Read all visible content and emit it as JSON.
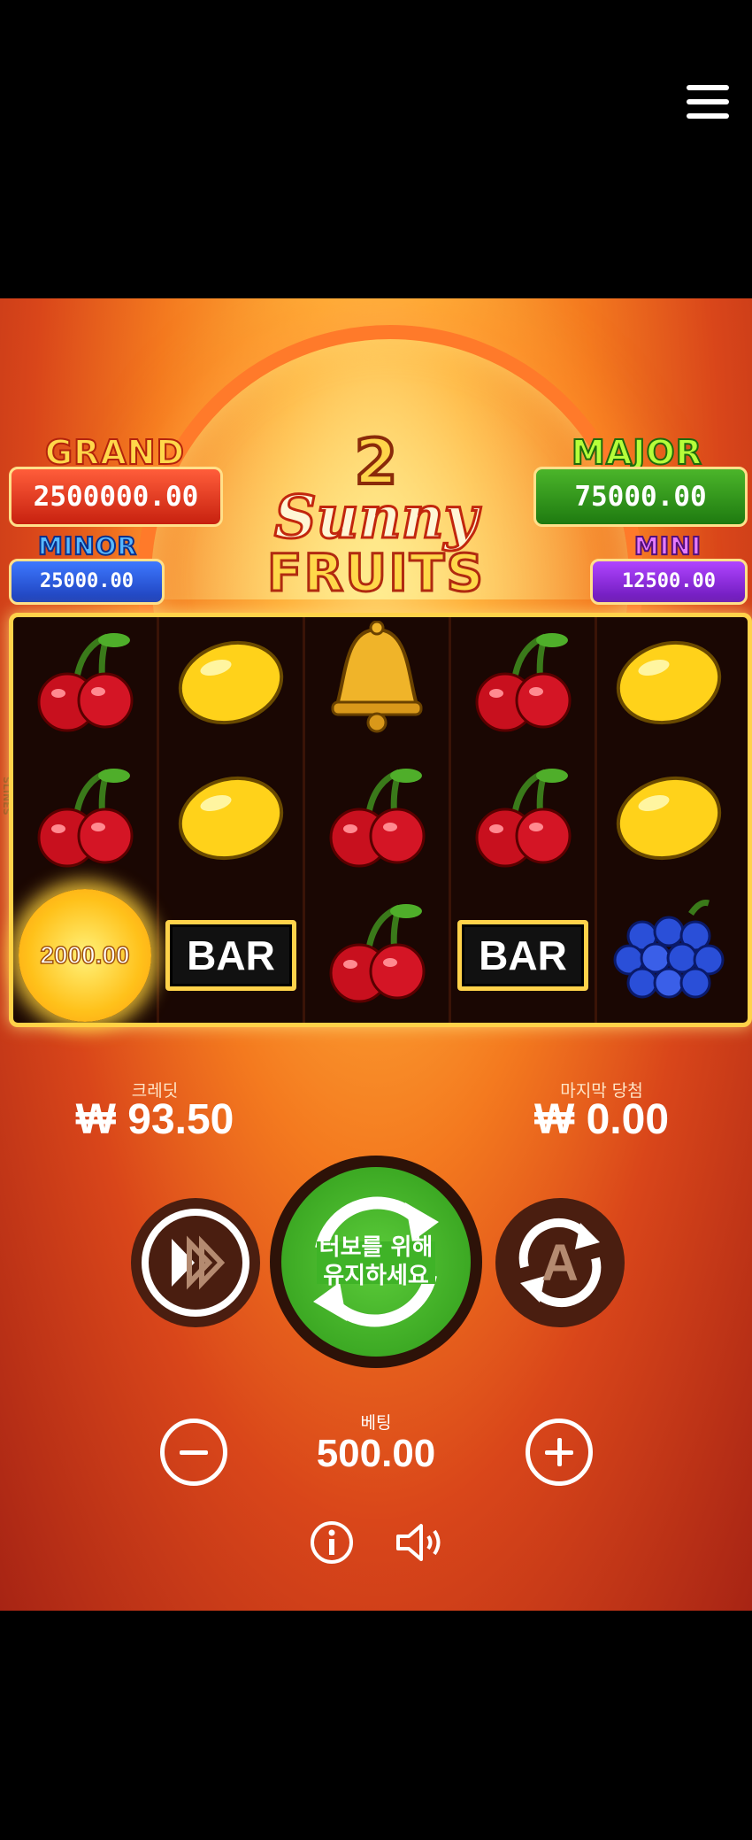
{
  "menu": {
    "icon": "hamburger-menu-icon"
  },
  "game": {
    "logo": {
      "number": "2",
      "line1": "Sunny",
      "line2": "FRUITS"
    },
    "side_label": "SLINES"
  },
  "jackpots": {
    "grand": {
      "label": "GRAND",
      "value": "2500000.00"
    },
    "major": {
      "label": "MAJOR",
      "value": "75000.00"
    },
    "minor": {
      "label": "MINOR",
      "value": "25000.00"
    },
    "mini": {
      "label": "MINI",
      "value": "12500.00"
    }
  },
  "reels": [
    [
      "cherry",
      "cherry",
      "sun"
    ],
    [
      "lemon",
      "lemon",
      "bar"
    ],
    [
      "bell",
      "cherry",
      "cherry"
    ],
    [
      "cherry",
      "cherry",
      "bar"
    ],
    [
      "lemon",
      "lemon",
      "grapes"
    ]
  ],
  "symbols": {
    "bar_text": "BAR",
    "sun_value": "2000.00"
  },
  "credit": {
    "label": "크레딧",
    "value": "₩ 93.50"
  },
  "last_win": {
    "label": "마지막 당첨",
    "value": "₩ 0.00"
  },
  "spin": {
    "line1": "터보를 위해",
    "line2": "유지하세요"
  },
  "auto": {
    "letter": "A"
  },
  "bet": {
    "label": "베팅",
    "value": "500.00"
  },
  "colors": {
    "grand": "#e0321a",
    "major": "#2f9a1a",
    "minor": "#2a5ae0",
    "mini": "#8a2ae0",
    "spin": "#3fb327"
  }
}
